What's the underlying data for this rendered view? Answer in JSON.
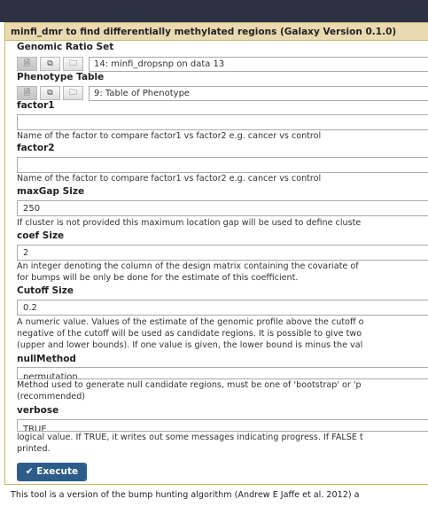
{
  "form": {
    "title": "minfi_dmr to find differentially methylated regions (Galaxy Version 0.1.0)",
    "genomic_ratio_set": {
      "label": "Genomic Ratio Set",
      "value": "14: minfi_dropsnp on data 13"
    },
    "phenotype_table": {
      "label": "Phenotype Table",
      "value": "9: Table of Phenotype"
    },
    "factor1": {
      "label": "factor1",
      "value": "",
      "help": "Name of the factor to compare factor1 vs factor2 e.g. cancer vs control"
    },
    "factor2": {
      "label": "factor2",
      "value": "",
      "help": "Name of the factor to compare factor1 vs factor2 e.g. cancer vs control"
    },
    "maxgap": {
      "label": "maxGap Size",
      "value": "250",
      "help": "If cluster is not provided this maximum location gap will be used to define cluste"
    },
    "coef": {
      "label": "coef Size",
      "value": "2",
      "help1": "An integer denoting the column of the design matrix containing the covariate of",
      "help2": "for bumps will be only be done for the estimate of this coefficient."
    },
    "cutoff": {
      "label": "Cutoff Size",
      "value": "0.2",
      "help1": "A numeric value. Values of the estimate of the genomic profile above the cutoff o",
      "help2": "negative of the cutoff will be used as candidate regions. It is possible to give two",
      "help3": "(upper and lower bounds). If one value is given, the lower bound is minus the val"
    },
    "nullmethod": {
      "label": "nullMethod",
      "value": "permutation",
      "help1": "Method used to generate null candidate regions, must be one of 'bootstrap' or 'p",
      "help2": "(recommended)"
    },
    "verbose": {
      "label": "verbose",
      "value": "TRUE",
      "help1": "logical value. If TRUE, it writes out some messages indicating progress. If FALSE t",
      "help2": "printed."
    },
    "execute_label": "Execute"
  },
  "footer_text": "This tool is a version of the bump hunting algorithm (Andrew E Jaffe et al. 2012) a",
  "colors": {
    "title_bg": "#ebd9b2",
    "execute_bg": "#2c5d8a",
    "topbar": "#2c3143"
  }
}
